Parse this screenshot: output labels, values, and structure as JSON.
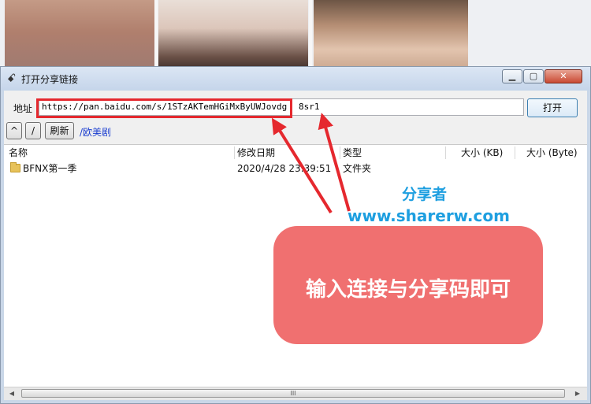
{
  "window": {
    "title": "打开分享链接"
  },
  "address": {
    "label": "地址",
    "url": "https://pan.baidu.com/s/1STzAKTemHGiMxByUWJovdg",
    "extract_code": "8sr1",
    "open_button": "打开"
  },
  "toolbar": {
    "up": "^",
    "root": "/",
    "refresh": "刷新",
    "current_path": "/欧美剧"
  },
  "columns": [
    "名称",
    "修改日期",
    "类型",
    "大小 (KB)",
    "大小 (Byte)"
  ],
  "rows": [
    {
      "name": "BFNX第一季",
      "modified": "2020/4/28 23:39:51",
      "type": "文件夹"
    }
  ],
  "scrollbar": {
    "left": "◀",
    "right": "▶",
    "grip": "III"
  },
  "overlay": {
    "brand_name": "分享者",
    "brand_url": "www.sharerw.com",
    "callout": "输入连接与分享码即可",
    "accent_color": "#e5282e",
    "callout_color": "#f07070",
    "brand_color": "#1e9fe0"
  },
  "icons": {
    "title": "app-icon",
    "folder": "folder-icon"
  }
}
